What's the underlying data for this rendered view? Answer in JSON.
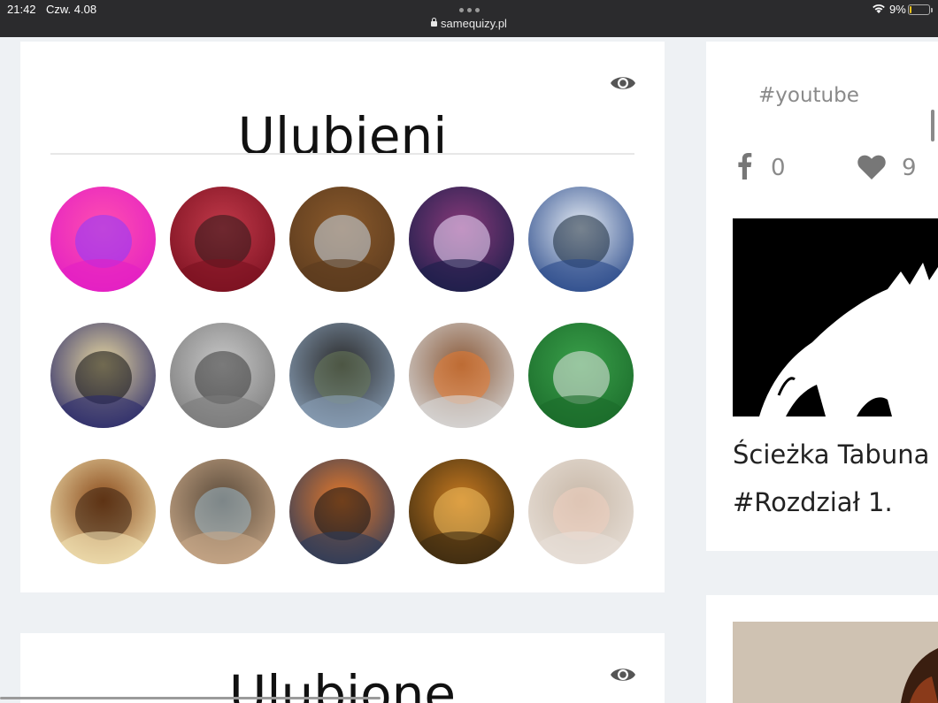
{
  "status_bar": {
    "time": "21:42",
    "date": "Czw. 4.08",
    "url": "samequizy.pl",
    "battery": "9%"
  },
  "favorites_card": {
    "title": "Ulubieni",
    "avatars": [
      {
        "name": "avatar-1",
        "colors": [
          "#e21ec4",
          "#ff4fb0",
          "#8a3cff"
        ]
      },
      {
        "name": "avatar-2",
        "colors": [
          "#7a1020",
          "#c23a4a",
          "#2a1a1a"
        ]
      },
      {
        "name": "avatar-3",
        "colors": [
          "#5a3a1e",
          "#8b5a2b",
          "#c8d8e8"
        ]
      },
      {
        "name": "avatar-4",
        "colors": [
          "#1a1e4a",
          "#8a3a7a",
          "#f0e0ff"
        ]
      },
      {
        "name": "avatar-5",
        "colors": [
          "#2a4a8a",
          "#e8eef5",
          "#1a2a3a"
        ]
      },
      {
        "name": "avatar-6",
        "colors": [
          "#2a2a6a",
          "#e8d8a0",
          "#111"
        ]
      },
      {
        "name": "avatar-7",
        "colors": [
          "#7a7a7a",
          "#c8c8c8",
          "#3a3a3a"
        ]
      },
      {
        "name": "avatar-8",
        "colors": [
          "#8aa0b8",
          "#2a2a2a",
          "#6a7a5a"
        ]
      },
      {
        "name": "avatar-9",
        "colors": [
          "#d8d8d8",
          "#8a5a3a",
          "#e87a30"
        ]
      },
      {
        "name": "avatar-10",
        "colors": [
          "#1a6a2a",
          "#3aa04a",
          "#e8e8e8"
        ]
      },
      {
        "name": "avatar-11",
        "colors": [
          "#f0e0b0",
          "#8a4a1a",
          "#3a2010"
        ]
      },
      {
        "name": "avatar-12",
        "colors": [
          "#c8a888",
          "#5a4a3a",
          "#9ab8c8"
        ]
      },
      {
        "name": "avatar-13",
        "colors": [
          "#2a3a5a",
          "#e87a2a",
          "#111"
        ]
      },
      {
        "name": "avatar-14",
        "colors": [
          "#3a2a10",
          "#c87a20",
          "#f0c060"
        ]
      },
      {
        "name": "avatar-15",
        "colors": [
          "#e8e0d8",
          "#c8b8a8",
          "#f0d0c0"
        ]
      }
    ]
  },
  "favorites_card_2": {
    "title": "Ulubione"
  },
  "side_post": {
    "hashtag": "#youtube",
    "fb_count": "0",
    "heart_count": "9",
    "title_line1": "Ścieżka Tabuna",
    "title_line2": "#Rozdział 1."
  }
}
